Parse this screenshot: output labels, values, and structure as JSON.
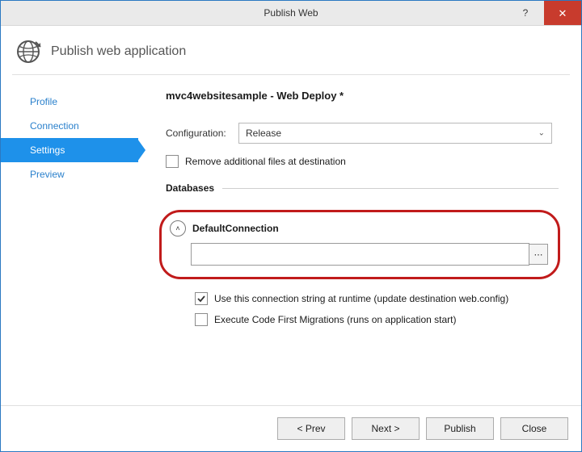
{
  "window": {
    "title": "Publish Web"
  },
  "header": {
    "app_title": "Publish web application"
  },
  "sidebar": {
    "items": [
      {
        "label": "Profile"
      },
      {
        "label": "Connection"
      },
      {
        "label": "Settings"
      },
      {
        "label": "Preview"
      }
    ]
  },
  "main": {
    "page_title": "mvc4websitesample - Web Deploy *",
    "config_label": "Configuration:",
    "config_value": "Release",
    "remove_files_label": "Remove additional files at destination",
    "databases_title": "Databases",
    "db": {
      "name": "DefaultConnection",
      "conn_string": "",
      "use_runtime_label": "Use this connection string at runtime (update destination web.config)",
      "execute_cf_label": "Execute Code First Migrations (runs on application start)"
    }
  },
  "footer": {
    "prev": "< Prev",
    "next": "Next >",
    "publish": "Publish",
    "close": "Close"
  }
}
